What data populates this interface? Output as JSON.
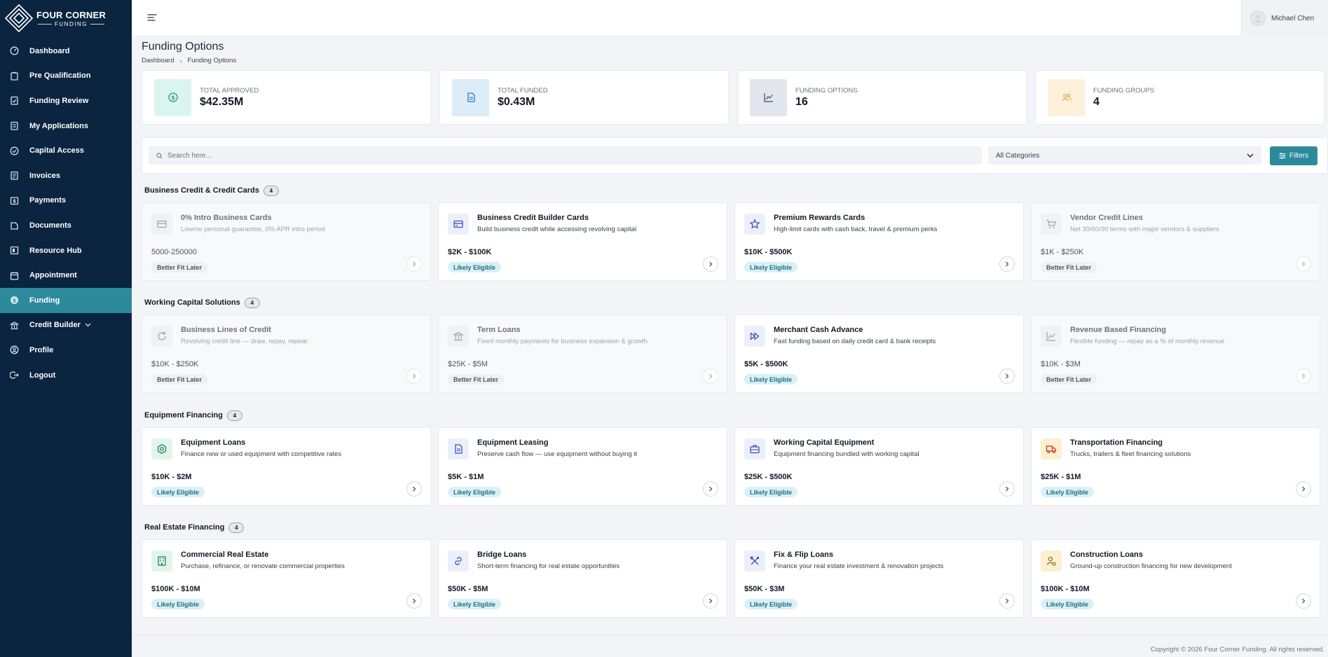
{
  "brand": {
    "name": "FOUR CORNER",
    "sub": "FUNDING"
  },
  "sidebar": {
    "items": [
      {
        "label": "Dashboard",
        "icon": "dashboard-icon"
      },
      {
        "label": "Pre Qualification",
        "icon": "clipboard-icon"
      },
      {
        "label": "Funding Review",
        "icon": "document-check-icon"
      },
      {
        "label": "My Applications",
        "icon": "list-icon"
      },
      {
        "label": "Capital Access",
        "icon": "circle-check-icon"
      },
      {
        "label": "Invoices",
        "icon": "invoice-icon"
      },
      {
        "label": "Payments",
        "icon": "payment-icon"
      },
      {
        "label": "Documents",
        "icon": "folder-icon"
      },
      {
        "label": "Resource Hub",
        "icon": "hub-icon"
      },
      {
        "label": "Appointment",
        "icon": "calendar-icon"
      },
      {
        "label": "Funding",
        "icon": "funding-icon",
        "active": true
      },
      {
        "label": "Credit Builder",
        "icon": "bank-icon",
        "expandable": true
      },
      {
        "label": "Profile",
        "icon": "user-circle-icon"
      },
      {
        "label": "Logout",
        "icon": "logout-icon"
      }
    ]
  },
  "header": {
    "user_name": "Michael Chen"
  },
  "page": {
    "title": "Funding Options",
    "breadcrumb": [
      "Dashboard",
      "Funding Options"
    ]
  },
  "stats": [
    {
      "label": "TOTAL APPROVED",
      "value": "$42.35M",
      "icon": "dollar-icon",
      "bg": "#dcf4ee",
      "fg": "#1e9e85"
    },
    {
      "label": "TOTAL FUNDED",
      "value": "$0.43M",
      "icon": "document-icon",
      "bg": "#dcecf9",
      "fg": "#2b7bc0"
    },
    {
      "label": "FUNDING OPTIONS",
      "value": "16",
      "icon": "chart-line-icon",
      "bg": "#e3e6ee",
      "fg": "#3b4a6b"
    },
    {
      "label": "FUNDING GROUPS",
      "value": "4",
      "icon": "users-icon",
      "bg": "#fdf1dc",
      "fg": "#e0a340"
    }
  ],
  "search": {
    "placeholder": "Search here...",
    "category": "All Categories",
    "filters_label": "Filters"
  },
  "sections": [
    {
      "title": "Business Credit & Credit Cards",
      "count": "4",
      "cards": [
        {
          "title": "0% Intro Business Cards",
          "desc": "Low/no personal guarantee, 0% APR intro period",
          "range": "5000-250000",
          "badge": "Better Fit Later",
          "eligible": false,
          "icon": "card-icon"
        },
        {
          "title": "Business Credit Builder Cards",
          "desc": "Build business credit while accessing revolving capital",
          "range": "$2K - $100K",
          "badge": "Likely Eligible",
          "eligible": true,
          "icon": "credit-card-icon"
        },
        {
          "title": "Premium Rewards Cards",
          "desc": "High-limit cards with cash back, travel & premium perks",
          "range": "$10K - $500K",
          "badge": "Likely Eligible",
          "eligible": true,
          "icon": "star-icon"
        },
        {
          "title": "Vendor Credit Lines",
          "desc": "Net 30/60/90 terms with major vendors & suppliers",
          "range": "$1K - $250K",
          "badge": "Better Fit Later",
          "eligible": false,
          "icon": "cart-icon"
        }
      ]
    },
    {
      "title": "Working Capital Solutions",
      "count": "4",
      "cards": [
        {
          "title": "Business Lines of Credit",
          "desc": "Revolving credit line — draw, repay, repeat",
          "range": "$10K - $250K",
          "badge": "Better Fit Later",
          "eligible": false,
          "icon": "refresh-icon"
        },
        {
          "title": "Term Loans",
          "desc": "Fixed monthly payments for business expansion & growth",
          "range": "$25K - $5M",
          "badge": "Better Fit Later",
          "eligible": false,
          "icon": "bank-icon"
        },
        {
          "title": "Merchant Cash Advance",
          "desc": "Fast funding based on daily credit card & bank receipts",
          "range": "$5K - $500K",
          "badge": "Likely Eligible",
          "eligible": true,
          "icon": "fast-forward-icon"
        },
        {
          "title": "Revenue Based Financing",
          "desc": "Flexible funding — repay as a % of monthly revenue",
          "range": "$10K - $3M",
          "badge": "Better Fit Later",
          "eligible": false,
          "icon": "chart-line-icon"
        }
      ]
    },
    {
      "title": "Equipment Financing",
      "count": "4",
      "cards": [
        {
          "title": "Equipment Loans",
          "desc": "Finance new or used equipment with competitive rates",
          "range": "$10K - $2M",
          "badge": "Likely Eligible",
          "eligible": true,
          "icon": "gear-icon"
        },
        {
          "title": "Equipment Leasing",
          "desc": "Preserve cash flow — use equipment without buying it",
          "range": "$5K - $1M",
          "badge": "Likely Eligible",
          "eligible": true,
          "icon": "document-icon"
        },
        {
          "title": "Working Capital Equipment",
          "desc": "Equipment financing bundled with working capital",
          "range": "$25K - $500K",
          "badge": "Likely Eligible",
          "eligible": true,
          "icon": "briefcase-icon"
        },
        {
          "title": "Transportation Financing",
          "desc": "Trucks, trailers & fleet financing solutions",
          "range": "$25K - $1M",
          "badge": "Likely Eligible",
          "eligible": true,
          "icon": "truck-icon"
        }
      ]
    },
    {
      "title": "Real Estate Financing",
      "count": "4",
      "cards": [
        {
          "title": "Commercial Real Estate",
          "desc": "Purchase, refinance, or renovate commercial properties",
          "range": "$100K - $10M",
          "badge": "Likely Eligible",
          "eligible": true,
          "icon": "building-icon"
        },
        {
          "title": "Bridge Loans",
          "desc": "Short-term financing for real estate opportunities",
          "range": "$50K - $5M",
          "badge": "Likely Eligible",
          "eligible": true,
          "icon": "link-icon"
        },
        {
          "title": "Fix & Flip Loans",
          "desc": "Finance your real estate investment & renovation projects",
          "range": "$50K - $3M",
          "badge": "Likely Eligible",
          "eligible": true,
          "icon": "tools-icon"
        },
        {
          "title": "Construction Loans",
          "desc": "Ground-up construction financing for new development",
          "range": "$100K - $10M",
          "badge": "Likely Eligible",
          "eligible": true,
          "icon": "construction-icon"
        }
      ]
    }
  ],
  "footer": {
    "copyright": "Copyright © 2026 Four Corner Funding. All rights reserved."
  }
}
